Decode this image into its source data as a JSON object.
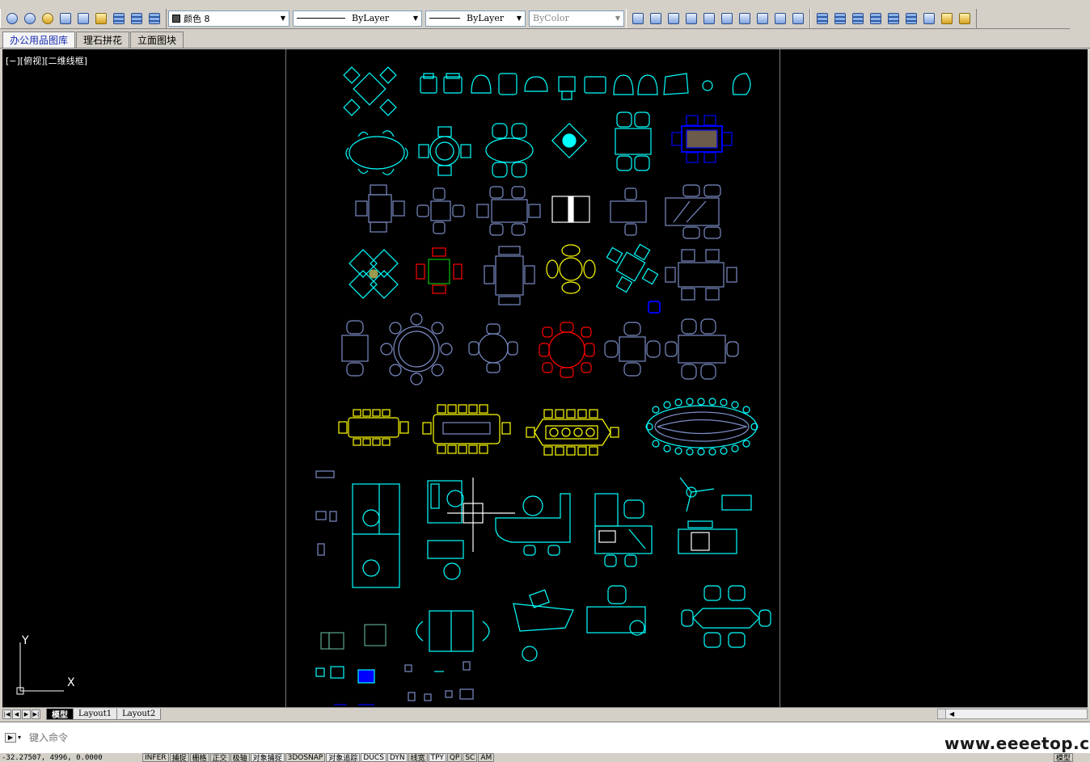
{
  "toolbar": {
    "color_control": "颜色 8",
    "linetype_control": "ByLayer",
    "lineweight_control": "ByLayer",
    "plotstyle_control": "ByColor"
  },
  "palette_tabs": [
    {
      "label": "办公用品图库",
      "active": true
    },
    {
      "label": "理石拼花",
      "active": false
    },
    {
      "label": "立面图块",
      "active": false
    }
  ],
  "viewport": {
    "label": "[−][俯视][二维线框]"
  },
  "ucs": {
    "y_label": "Y",
    "x_label": "X"
  },
  "layout_tabs": [
    {
      "label": "模型",
      "active": true
    },
    {
      "label": "Layout1",
      "active": false
    },
    {
      "label": "Layout2",
      "active": false
    }
  ],
  "command": {
    "placeholder": "键入命令"
  },
  "watermark": "www.eeeetop.com",
  "status": {
    "coordinates": "-32.27507, 4996, 0.0000",
    "buttons": [
      {
        "label": "INFER",
        "on": false
      },
      {
        "label": "捕捉",
        "on": false
      },
      {
        "label": "栅格",
        "on": false
      },
      {
        "label": "正交",
        "on": false
      },
      {
        "label": "极轴",
        "on": false
      },
      {
        "label": "对象捕捉",
        "on": true
      },
      {
        "label": "3DOSNAP",
        "on": false
      },
      {
        "label": "对象追踪",
        "on": true
      },
      {
        "label": "DUCS",
        "on": true
      },
      {
        "label": "DYN",
        "on": true
      },
      {
        "label": "线宽",
        "on": false
      },
      {
        "label": "TPY",
        "on": true
      },
      {
        "label": "QP",
        "on": false
      },
      {
        "label": "SC",
        "on": false
      },
      {
        "label": "AM",
        "on": false
      }
    ],
    "model_label": "模型"
  },
  "colors": {
    "cyan": "#00ffff",
    "blue_grey": "#7b8cc6",
    "yellow": "#ffff00",
    "red": "#ff0000",
    "blue": "#0000ff",
    "white": "#ffffff",
    "green": "#00c000",
    "viewport_bg": "#000000"
  }
}
